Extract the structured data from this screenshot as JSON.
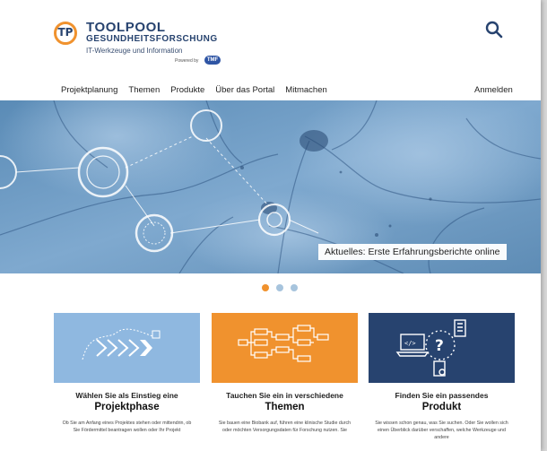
{
  "brand": {
    "logo_text": "TP",
    "line1": "TOOLPOOL",
    "line2": "GESUNDHEITSFORSCHUNG",
    "line3": "IT-Werkzeuge und Information",
    "powered_by": "Powered by",
    "powered_badge": "TMF"
  },
  "nav": {
    "items": [
      "Projektplanung",
      "Themen",
      "Produkte",
      "Über das Portal",
      "Mitmachen"
    ],
    "login": "Anmelden"
  },
  "hero": {
    "caption": "Aktuelles: Erste Erfahrungsberichte online",
    "dots": [
      true,
      false,
      false
    ]
  },
  "cards": [
    {
      "title_small": "Wählen Sie als Einstieg eine",
      "title_big": "Projektphase",
      "text": "Ob Sie am Anfang eines Projektes stehen oder mittendrin, ob Sie Fördermittel beantragen wollen oder Ihr Projekt",
      "color": "#8fb8e0"
    },
    {
      "title_small": "Tauchen Sie ein in verschiedene",
      "title_big": "Themen",
      "text": "Sie bauen eine Biobank auf, führen eine klinische Studie durch oder möchten Versorgungsdaten für Forschung nutzen. Sie",
      "color": "#f0922e"
    },
    {
      "title_small": "Finden Sie ein passendes",
      "title_big": "Produkt",
      "text": "Sie wissen schon genau, was Sie suchen. Oder Sie wollen sich einen Überblick darüber verschaffen, welche Werkzeuge und andere",
      "color": "#27436f"
    }
  ],
  "icons": [
    "search-icon",
    "chevrons-icon",
    "flowchart-icon",
    "laptop-question-icon"
  ],
  "colors": {
    "brand_navy": "#27436f",
    "accent_orange": "#f0922e",
    "light_blue": "#8fb8e0"
  }
}
